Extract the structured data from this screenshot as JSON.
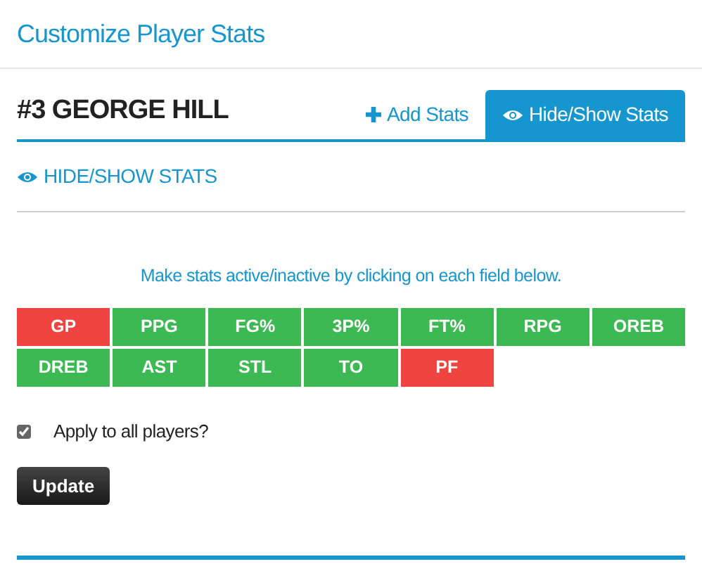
{
  "page_title": "Customize Player Stats",
  "player": {
    "name": "#3 GEORGE HILL"
  },
  "tabs": [
    {
      "label": "Add Stats",
      "kind": "add",
      "selected": false
    },
    {
      "label": "Hide/Show Stats",
      "kind": "visibility",
      "selected": true
    }
  ],
  "section": {
    "heading": "HIDE/SHOW STATS",
    "instruction": "Make stats active/inactive by clicking on each field below."
  },
  "stats": [
    {
      "label": "GP",
      "active": false
    },
    {
      "label": "PPG",
      "active": true
    },
    {
      "label": "FG%",
      "active": true
    },
    {
      "label": "3P%",
      "active": true
    },
    {
      "label": "FT%",
      "active": true
    },
    {
      "label": "RPG",
      "active": true
    },
    {
      "label": "OREB",
      "active": true
    },
    {
      "label": "DREB",
      "active": true
    },
    {
      "label": "AST",
      "active": true
    },
    {
      "label": "STL",
      "active": true
    },
    {
      "label": "TO",
      "active": true
    },
    {
      "label": "PF",
      "active": false
    }
  ],
  "apply_all": {
    "label": "Apply to all players?",
    "checked": true
  },
  "update_button": "Update"
}
